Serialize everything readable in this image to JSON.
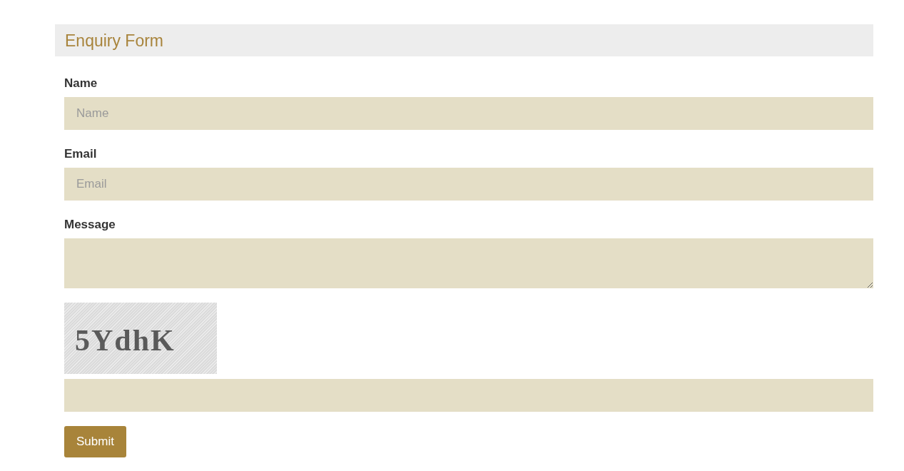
{
  "header": {
    "title": "Enquiry Form"
  },
  "fields": [
    {
      "kind": "input",
      "label": "Name",
      "placeholder": "Name"
    },
    {
      "kind": "input",
      "label": "Email",
      "placeholder": "Email"
    },
    {
      "kind": "textarea",
      "label": "Message"
    }
  ],
  "captcha": {
    "code": "5YdhK"
  },
  "submit_button": {
    "label": "Submit"
  }
}
